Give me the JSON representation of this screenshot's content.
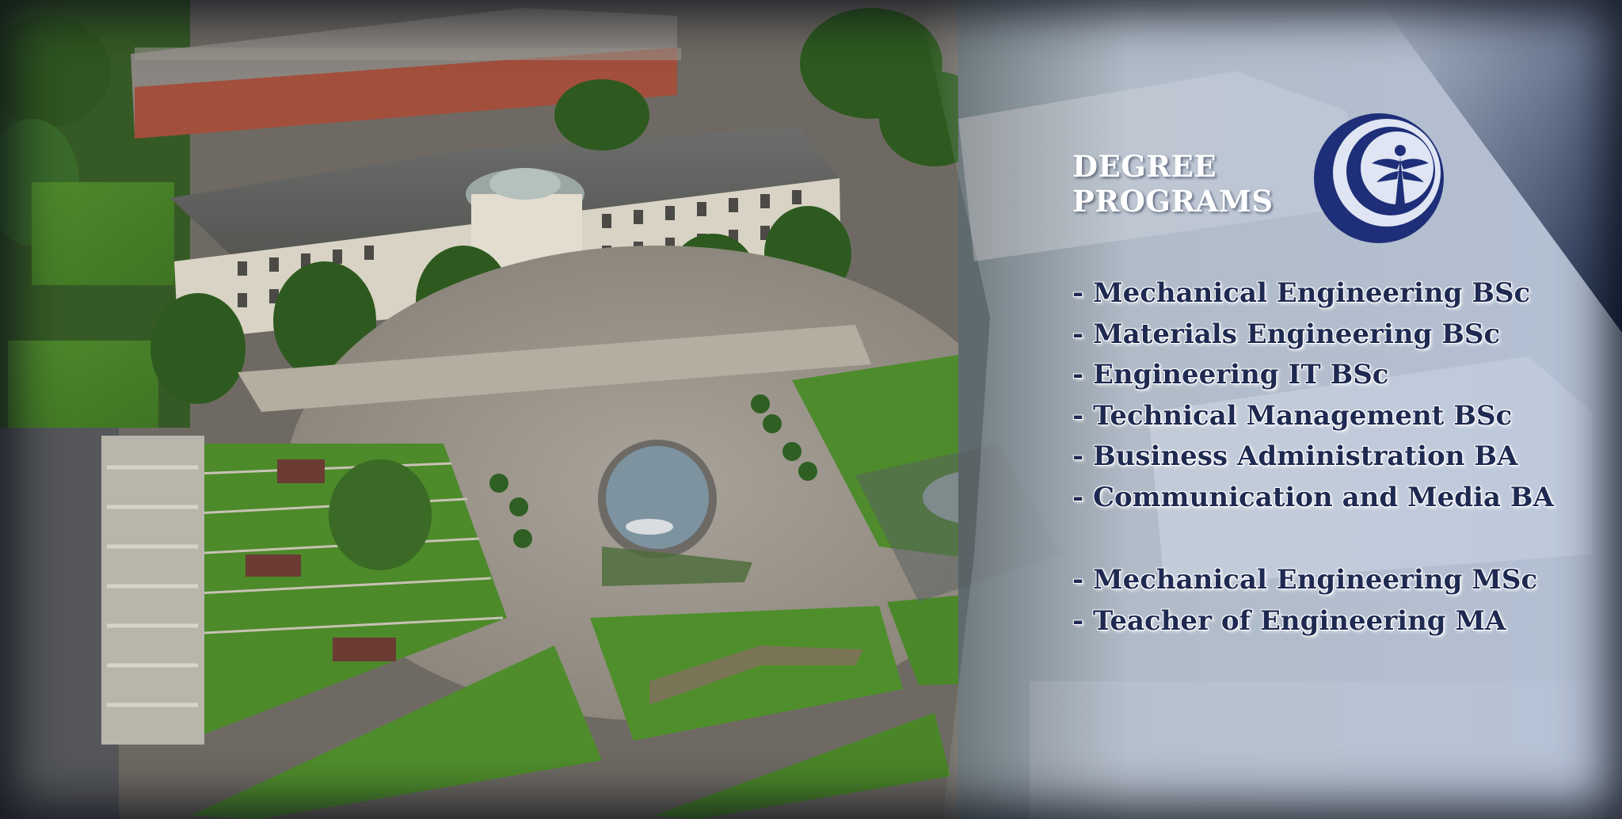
{
  "heading": {
    "line1": "DEGREE",
    "line2": "PROGRAMS"
  },
  "logo": {
    "icon": "university-logo-icon",
    "color": "#1f2f7a"
  },
  "bachelor_programs": [
    "- Mechanical Engineering BSc",
    "- Materials Engineering BSc",
    "- Engineering IT BSc",
    "- Technical Management BSc",
    "- Business Administration BA",
    "- Communication and Media BA"
  ],
  "master_programs": [
    "- Mechanical Engineering MSc",
    "- Teacher of Engineering MA"
  ],
  "colors": {
    "text_dark": "#1f2a52",
    "heading": "#ffffff",
    "overlay": "#c8d4ea"
  }
}
